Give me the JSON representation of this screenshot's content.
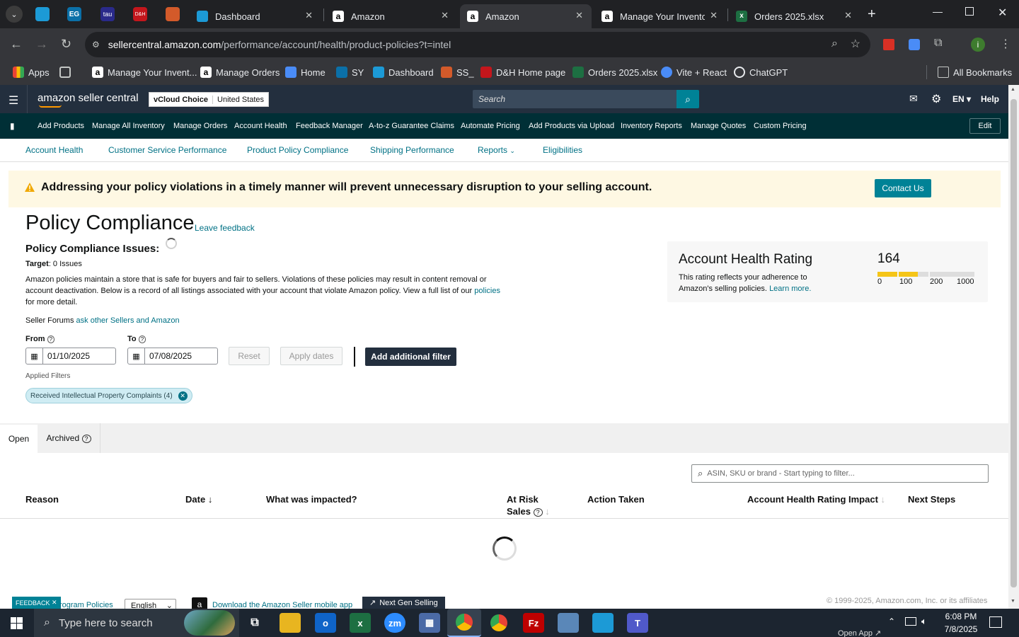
{
  "browser": {
    "tabs": [
      {
        "title": "Dashboard",
        "color": "#1c9ad6"
      },
      {
        "title": "Amazon",
        "color": "#ffffff"
      },
      {
        "title": "Amazon",
        "color": "#ffffff"
      },
      {
        "title": "Manage Your Inventor",
        "color": "#ffffff"
      },
      {
        "title": "Orders 2025.xlsx",
        "color": "#1d6f42"
      }
    ],
    "pinned_tabs": [
      {
        "label": "",
        "color": "#1c9ad6"
      },
      {
        "label": "EG",
        "color": "#0b70a8"
      },
      {
        "label": "tau",
        "color": "#2a2a8a"
      },
      {
        "label": "D&H",
        "color": "#c4161c"
      },
      {
        "label": "",
        "color": "#d35a2a"
      }
    ],
    "url_domain": "sellercentral.amazon.com",
    "url_path": "/performance/account/health/product-policies?t=intel",
    "profile_initial": "i",
    "bookmarks": [
      {
        "label": "Apps"
      },
      {
        "label": ""
      },
      {
        "label": "Manage Your Invent..."
      },
      {
        "label": "Manage Orders"
      },
      {
        "label": "Home"
      },
      {
        "label": "SY"
      },
      {
        "label": "Dashboard"
      },
      {
        "label": "SS_"
      },
      {
        "label": "D&H Home page"
      },
      {
        "label": "Orders 2025.xlsx"
      },
      {
        "label": "Vite + React"
      },
      {
        "label": "ChatGPT"
      }
    ],
    "all_bookmarks": "All Bookmarks"
  },
  "amazon": {
    "logo": "amazon seller central",
    "store_name": "vCloud Choice",
    "store_country": "United States",
    "search_placeholder": "Search",
    "language": "EN",
    "help": "Help",
    "subnav": [
      "Add Products",
      "Manage All Inventory",
      "Manage Orders",
      "Account Health",
      "Feedback Manager",
      "A-to-z Guarantee Claims",
      "Automate Pricing",
      "Add Products via Upload",
      "Inventory Reports",
      "Manage Quotes",
      "Custom Pricing"
    ],
    "edit": "Edit",
    "ah_nav": [
      "Account Health",
      "Customer Service Performance",
      "Product Policy Compliance",
      "Shipping Performance",
      "Reports",
      "Eligibilities"
    ]
  },
  "banner": {
    "text": "Addressing your policy violations in a timely manner will prevent unnecessary disruption to your selling account.",
    "button": "Contact Us"
  },
  "page": {
    "title": "Policy Compliance",
    "leave_feedback": "Leave feedback",
    "issues_heading": "Policy Compliance Issues:",
    "target_label": "Target",
    "target_value": ": 0 Issues",
    "description": "Amazon policies maintain a store that is safe for buyers and fair to sellers. Violations of these policies may result in content removal or account deactivation. Below is a record of all listings associated with your account that violate Amazon policy. View a full list of our",
    "policies_link": "policies",
    "description_end": "for more detail.",
    "forums_prefix": "Seller Forums",
    "forums_link": "ask other Sellers and Amazon"
  },
  "rating": {
    "title": "Account Health Rating",
    "value": "164",
    "desc": "This rating reflects your adherence to Amazon's selling policies.",
    "learn_more": "Learn more.",
    "scale": [
      "0",
      "100",
      "200",
      "1000"
    ],
    "fill_color": "#f5c518"
  },
  "filters": {
    "from_label": "From",
    "to_label": "To",
    "from_date": "01/10/2025",
    "to_date": "07/08/2025",
    "reset": "Reset",
    "apply": "Apply dates",
    "add_filter": "Add additional filter",
    "applied_label": "Applied Filters",
    "chip": "Received Intellectual Property Complaints (4)"
  },
  "results": {
    "tabs": [
      "Open",
      "Archived"
    ],
    "search_placeholder": "ASIN, SKU or brand - Start typing to filter...",
    "columns": [
      "Reason",
      "Date",
      "What was impacted?",
      "At Risk",
      "Sales",
      "Action Taken",
      "Account Health Rating Impact",
      "Next Steps"
    ]
  },
  "footer": {
    "feedback": "FEEDBACK",
    "program_policies": "rogram Policies",
    "language": "English",
    "download_app": "Download the Amazon Seller mobile app",
    "next_gen": "Next Gen Selling",
    "copyright": "© 1999-2025, Amazon.com, Inc. or its affiliates"
  },
  "taskbar": {
    "search_placeholder": "Type here to search",
    "time": "6:08 PM",
    "date": "7/8/2025",
    "open_app": "Open App ↗"
  }
}
